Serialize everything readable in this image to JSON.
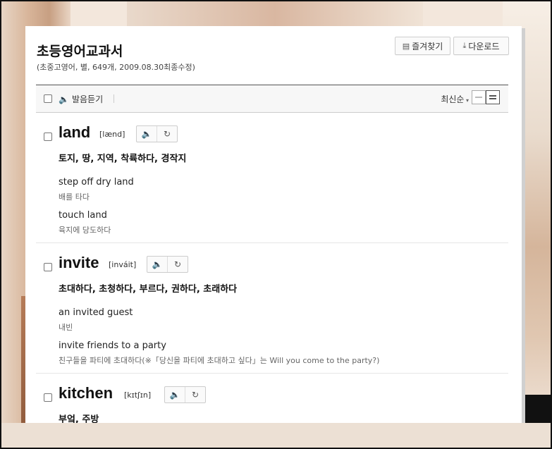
{
  "wordbook": {
    "title": "초등영어교과서",
    "subtitle": "(초중고영어, 별, 649개, 2009.08.30최종수정)",
    "favorite_label": "즐겨찾기",
    "download_label": "다운로드"
  },
  "toolbar": {
    "listen_label": "발음듣기",
    "sort_label": "최신순"
  },
  "entries": [
    {
      "word": "land",
      "pron": "[lænd]",
      "meaning": "토지, 땅, 지역, 착륙하다, 경작지",
      "examples": [
        {
          "en": "step off dry land",
          "ko": "배를 타다"
        },
        {
          "en": "touch land",
          "ko": "육지에 당도하다"
        }
      ]
    },
    {
      "word": "invite",
      "pron": "[inváit]",
      "meaning": "초대하다, 초청하다, 부르다, 권하다, 초래하다",
      "examples": [
        {
          "en": "an invited guest",
          "ko": "내빈"
        },
        {
          "en": "invite friends to a party",
          "ko": "친구들을 파티에 초대하다(※「당신을 파티에 초대하고 싶다」는 Will you come to the party?)"
        }
      ]
    },
    {
      "word": "kitchen",
      "pron": "[kɪtʃɪn]",
      "meaning": "부엌, 주방",
      "examples": []
    }
  ],
  "icons": {
    "bookmark": "list-icon",
    "download": "download-icon",
    "speaker": "speaker-icon",
    "repeat": "repeat-icon"
  }
}
